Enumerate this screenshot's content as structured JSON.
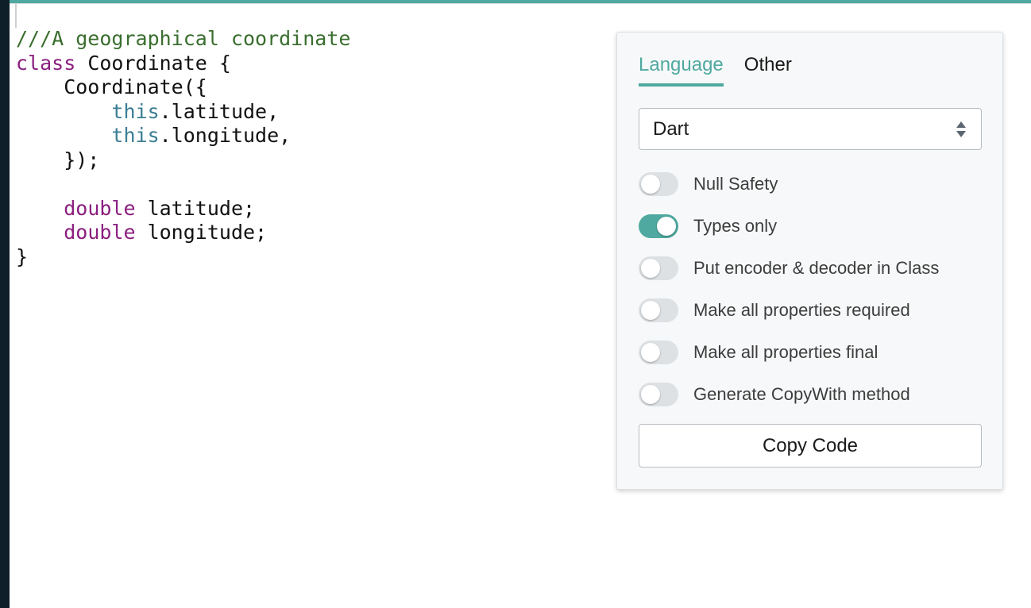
{
  "editor": {
    "lines": [
      [
        {
          "t": "///A geographical coordinate",
          "c": "comment"
        }
      ],
      [
        {
          "t": "class",
          "c": "keyword"
        },
        {
          "t": " Coordinate {",
          "c": "plain"
        }
      ],
      [
        {
          "t": "    Coordinate({",
          "c": "plain"
        }
      ],
      [
        {
          "t": "        ",
          "c": "plain"
        },
        {
          "t": "this",
          "c": "this"
        },
        {
          "t": ".latitude,",
          "c": "plain"
        }
      ],
      [
        {
          "t": "        ",
          "c": "plain"
        },
        {
          "t": "this",
          "c": "this"
        },
        {
          "t": ".longitude,",
          "c": "plain"
        }
      ],
      [
        {
          "t": "    });",
          "c": "plain"
        }
      ],
      [
        {
          "t": "",
          "c": "plain"
        }
      ],
      [
        {
          "t": "    ",
          "c": "plain"
        },
        {
          "t": "double",
          "c": "keyword"
        },
        {
          "t": " latitude;",
          "c": "plain"
        }
      ],
      [
        {
          "t": "    ",
          "c": "plain"
        },
        {
          "t": "double",
          "c": "keyword"
        },
        {
          "t": " longitude;",
          "c": "plain"
        }
      ],
      [
        {
          "t": "}",
          "c": "plain"
        }
      ]
    ]
  },
  "options": {
    "tabs": [
      {
        "label": "Language",
        "active": true
      },
      {
        "label": "Other",
        "active": false
      }
    ],
    "language_select": {
      "value": "Dart",
      "icon": "select-arrows-icon"
    },
    "toggles": [
      {
        "label": "Null Safety",
        "on": false
      },
      {
        "label": "Types only",
        "on": true
      },
      {
        "label": "Put encoder & decoder in Class",
        "on": false
      },
      {
        "label": "Make all properties required",
        "on": false
      },
      {
        "label": "Make all properties final",
        "on": false
      },
      {
        "label": "Generate CopyWith method",
        "on": false
      }
    ],
    "copy_button_label": "Copy Code"
  },
  "colors": {
    "accent": "#4fa9a0",
    "comment": "#3a6e2e",
    "keyword": "#8b1f7f",
    "this": "#3a7d94",
    "sidebar": "#0f1f29"
  }
}
